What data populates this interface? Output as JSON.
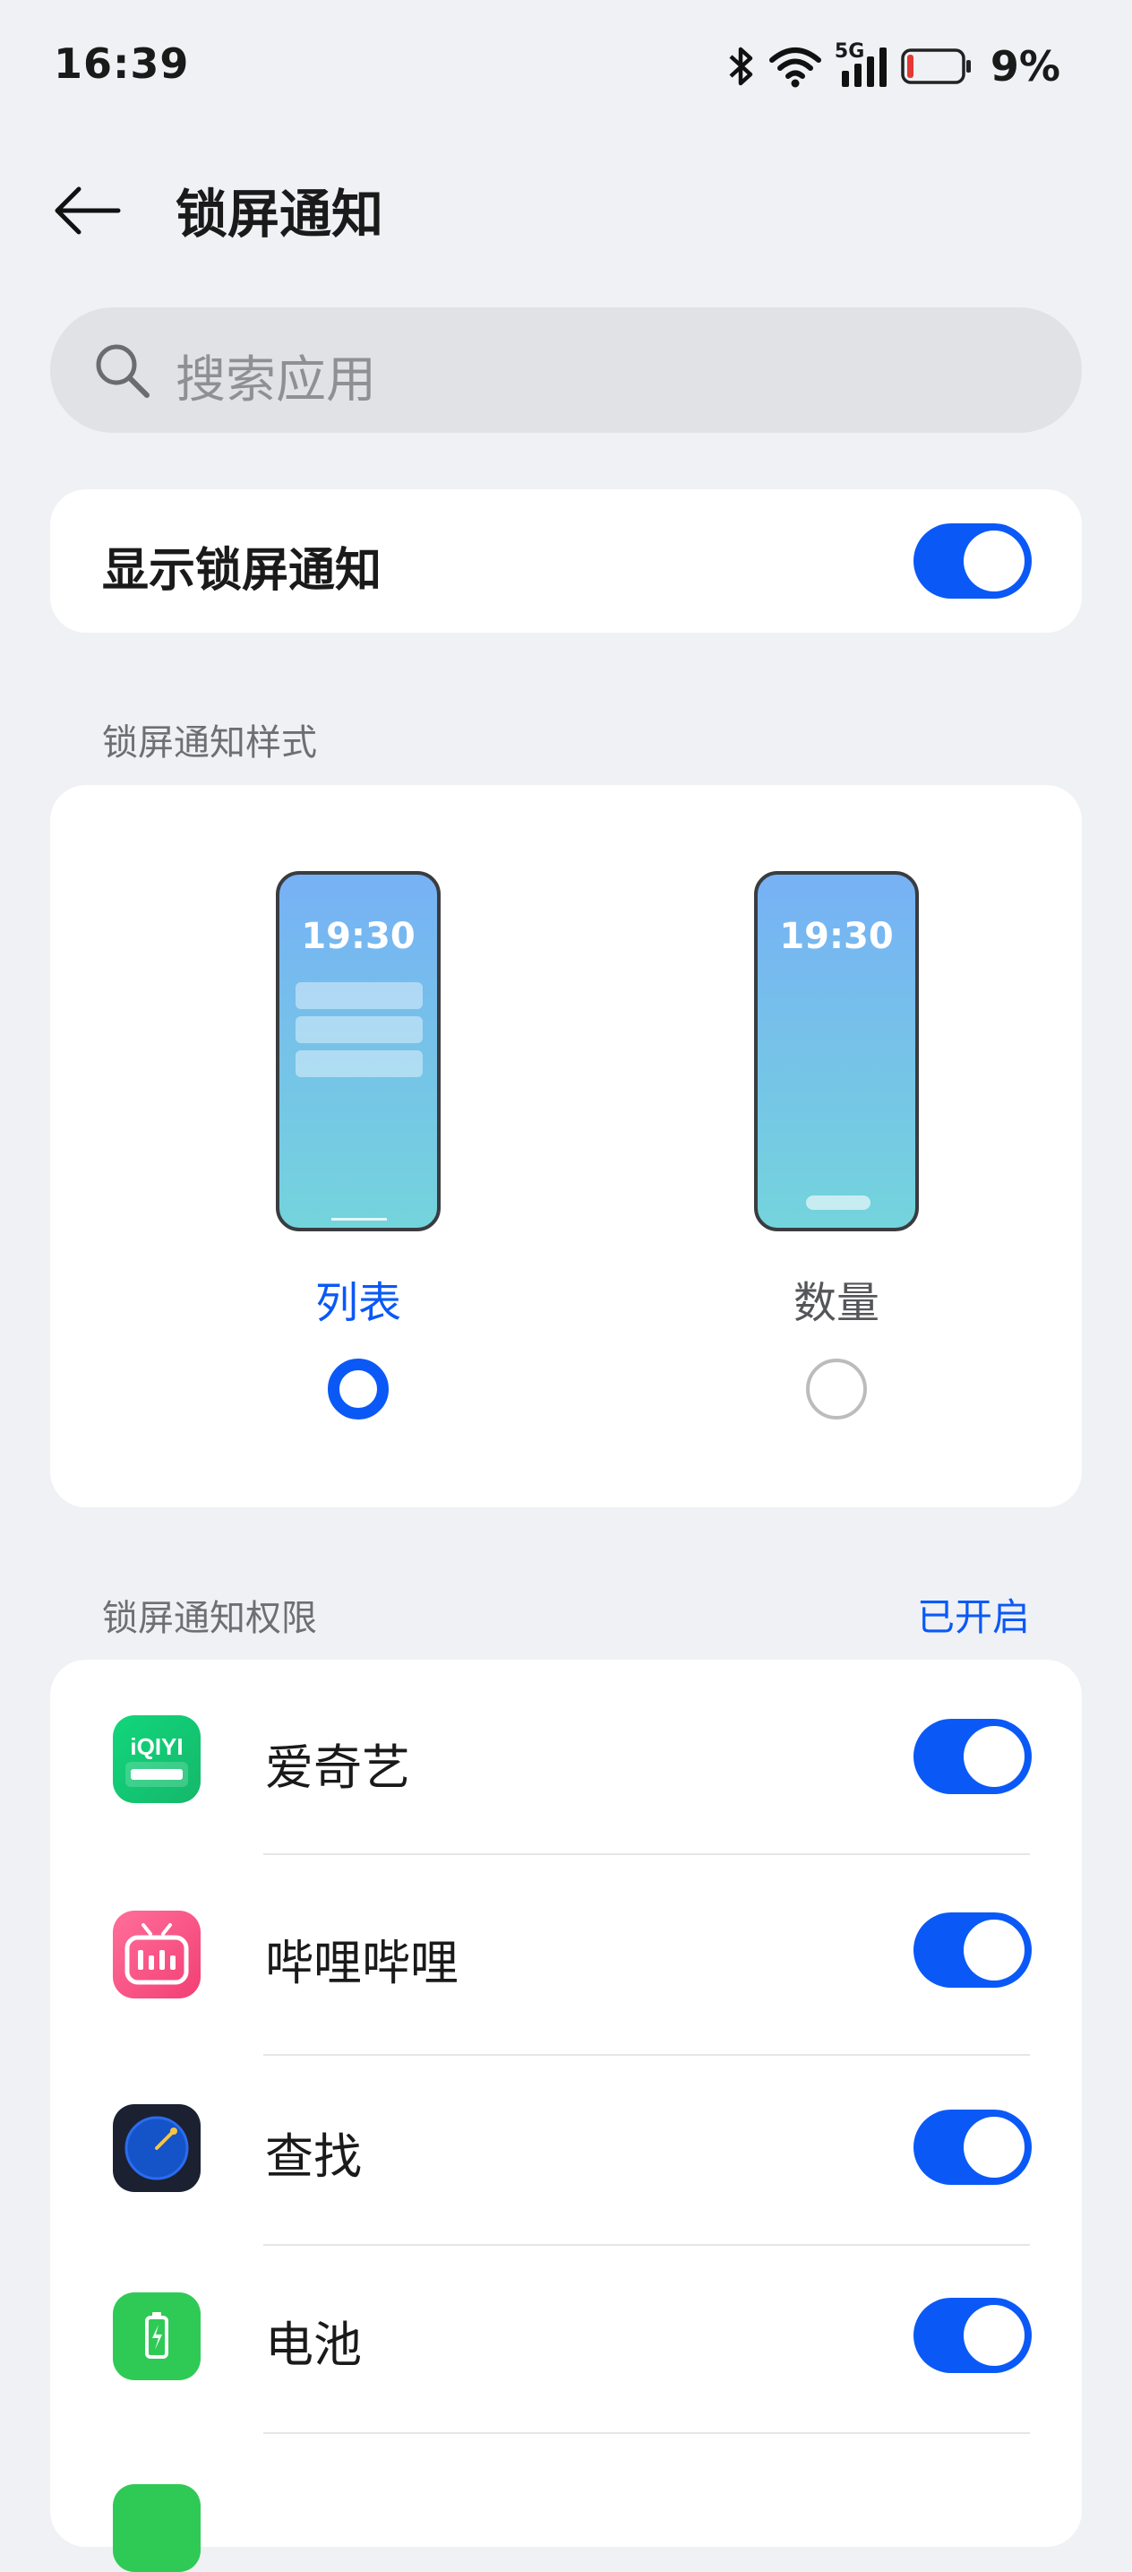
{
  "status_bar": {
    "time": "16:39",
    "network": "5G",
    "battery_percent": "9%",
    "battery_level": 0.09
  },
  "header": {
    "title": "锁屏通知"
  },
  "search": {
    "placeholder": "搜索应用"
  },
  "show_notifications": {
    "label": "显示锁屏通知",
    "enabled": true
  },
  "style_section": {
    "title": "锁屏通知样式",
    "options": [
      {
        "label": "列表",
        "clock": "19:30",
        "selected": true
      },
      {
        "label": "数量",
        "clock": "19:30",
        "selected": false
      }
    ]
  },
  "permissions_section": {
    "title": "锁屏通知权限",
    "status": "已开启",
    "apps": [
      {
        "name": "爱奇艺",
        "icon": "iqiyi-icon",
        "enabled": true
      },
      {
        "name": "哔哩哔哩",
        "icon": "bilibili-icon",
        "enabled": true
      },
      {
        "name": "查找",
        "icon": "find-device-icon",
        "enabled": true
      },
      {
        "name": "电池",
        "icon": "battery-app-icon",
        "enabled": true
      }
    ]
  },
  "colors": {
    "accent": "#0a59f7",
    "background": "#f0f1f5",
    "card": "#ffffff"
  }
}
